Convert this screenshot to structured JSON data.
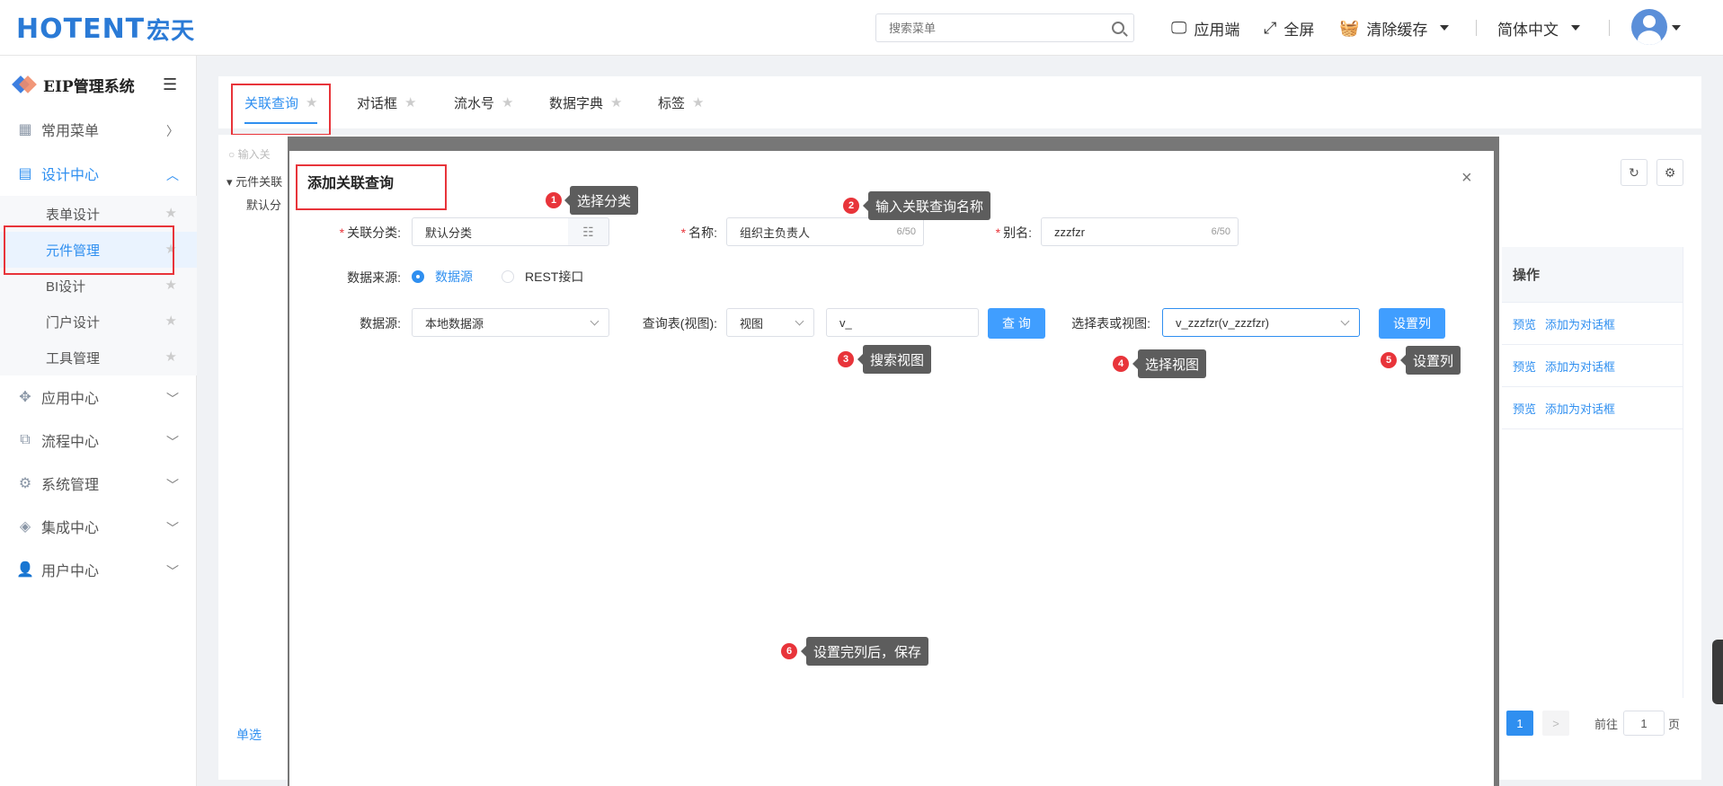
{
  "header": {
    "logo_text": "OTENT",
    "logo_h": "H",
    "logo_cn": "宏天",
    "search_placeholder": "搜索菜单",
    "app_client": "应用端",
    "fullscreen": "全屏",
    "clear_cache": "清除缓存",
    "language": "简体中文"
  },
  "sidebar": {
    "title": "EIP管理系统",
    "menus": [
      {
        "label": "常用菜单"
      },
      {
        "label": "设计中心"
      },
      {
        "label": "应用中心"
      },
      {
        "label": "流程中心"
      },
      {
        "label": "系统管理"
      },
      {
        "label": "集成中心"
      },
      {
        "label": "用户中心"
      }
    ],
    "submenus": [
      {
        "label": "表单设计"
      },
      {
        "label": "元件管理"
      },
      {
        "label": "BI设计"
      },
      {
        "label": "门户设计"
      },
      {
        "label": "工具管理"
      }
    ]
  },
  "tabs": [
    {
      "label": "关联查询"
    },
    {
      "label": "对话框"
    },
    {
      "label": "流水号"
    },
    {
      "label": "数据字典"
    },
    {
      "label": "标签"
    }
  ],
  "background": {
    "tree_search": "输入关",
    "tree_root": "元件关联",
    "tree_child": "默认分",
    "col_operation": "操作",
    "rows": [
      {
        "preview": "预览",
        "add": "添加为对话框"
      },
      {
        "preview": "预览",
        "add": "添加为对话框"
      },
      {
        "preview": "预览",
        "add": "添加为对话框"
      }
    ],
    "single_select": "单选",
    "pagination": {
      "current": "1",
      "next": ">",
      "goto": "前往",
      "page_input": "1",
      "page_unit": "页"
    }
  },
  "dialog": {
    "title": "添加关联查询",
    "close": "×",
    "category_label": "关联分类:",
    "category_value": "默认分类",
    "name_label": "名称:",
    "name_value": "组织主负责人",
    "name_count": "6/50",
    "alias_label": "别名:",
    "alias_value": "zzzfzr",
    "alias_count": "6/50",
    "datasource_type_label": "数据来源:",
    "datasource_type_options": [
      "数据源",
      "REST接口"
    ],
    "datasource_label": "数据源:",
    "datasource_value": "本地数据源",
    "query_table_label": "查询表(视图):",
    "query_table_type": "视图",
    "query_keyword": "v_",
    "query_button": "查 询",
    "select_view_label": "选择表或视图:",
    "select_view_value": "v_zzzfzr(v_zzzfzr)",
    "set_columns_button": "设置列"
  },
  "annotations": [
    {
      "num": "1",
      "text": "选择分类"
    },
    {
      "num": "2",
      "text": "输入关联查询名称"
    },
    {
      "num": "3",
      "text": "搜索视图"
    },
    {
      "num": "4",
      "text": "选择视图"
    },
    {
      "num": "5",
      "text": "设置列"
    },
    {
      "num": "6",
      "text": "设置完列后，保存"
    }
  ],
  "colors": {
    "primary": "#409eff",
    "highlight": "#e8343a",
    "tooltip": "#5d5d5d"
  }
}
